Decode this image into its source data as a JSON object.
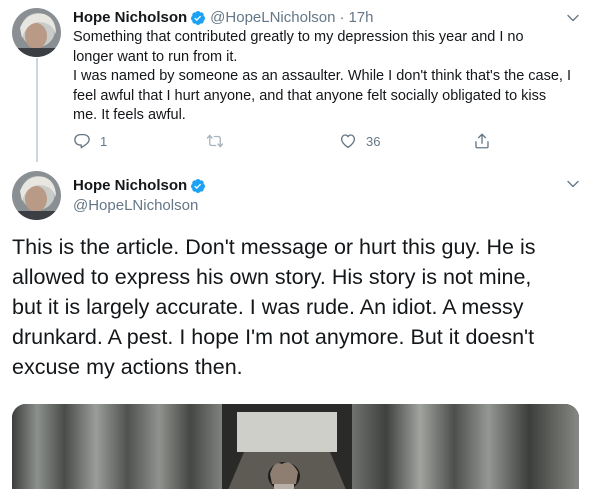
{
  "tweet1": {
    "name": "Hope Nicholson",
    "handle": "@HopeLNicholson",
    "separator": "·",
    "time": "17h",
    "text_lines": [
      "Something that contributed greatly to my depression this year and I no",
      "longer want to run from it.",
      "I was named by someone as an assaulter. While I don't think that's the case, I",
      "feel awful that I hurt anyone, and that anyone felt socially obligated to kiss",
      "me. It feels awful."
    ],
    "reply_count": "1",
    "like_count": "36"
  },
  "tweet2": {
    "name": "Hope Nicholson",
    "handle": "@HopeLNicholson",
    "text_lines": [
      "This is the article. Don't message or hurt this guy. He is",
      "allowed to express his own story. His story is not mine,",
      "but it is largely accurate. I was rude. An idiot. A messy",
      "drunkard. A pest. I hope I'm not anymore. But it doesn't",
      "excuse my actions then."
    ]
  },
  "colors": {
    "verified": "#1da1f2",
    "secondary_text": "#657786",
    "thread_line": "#ccd6dd"
  },
  "icons": [
    "verified-badge-icon",
    "chevron-down-icon",
    "reply-icon",
    "retweet-icon",
    "like-icon",
    "share-icon"
  ]
}
